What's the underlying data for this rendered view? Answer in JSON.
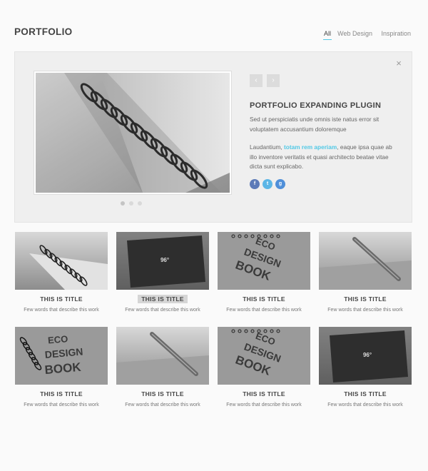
{
  "site_title": "PORTFOLIO",
  "filters": [
    "All",
    "Web Design",
    "Inspiration"
  ],
  "active_filter": "All",
  "accent_color": "#52c9e6",
  "expander": {
    "close_icon": "close-icon",
    "close_glyph": "×",
    "prev_glyph": "‹",
    "next_glyph": "›",
    "title": "PORTFOLIO EXPANDING PLUGIN",
    "paragraph1": "Sed ut perspiciatis unde omnis iste natus error sit voluptatem accusantium doloremque",
    "paragraph2_before": "Laudantium, ",
    "paragraph2_highlight": "totam rem aperiam",
    "paragraph2_after": ", eaque ipsa quae ab illo inventore veritatis et quasi architecto beatae vitae dicta sunt explicabo.",
    "social": [
      {
        "icon": "facebook-icon",
        "glyph": "f"
      },
      {
        "icon": "twitter-icon",
        "glyph": "t"
      },
      {
        "icon": "google-plus-icon",
        "glyph": "g"
      }
    ],
    "slide_count": 3,
    "active_slide": 1
  },
  "items": [
    {
      "title": "THIS IS TITLE",
      "desc": "Few words that describe this work",
      "image": "spiral-notebook"
    },
    {
      "title": "THIS IS TITLE",
      "desc": "Few words that describe this work",
      "image": "notebook-cover"
    },
    {
      "title": "THIS IS TITLE",
      "desc": "Few words that describe this work",
      "image": "eco-design-book"
    },
    {
      "title": "THIS IS TITLE",
      "desc": "Few words that describe this work",
      "image": "pen"
    },
    {
      "title": "THIS IS TITLE",
      "desc": "Few words that describe this work",
      "image": "eco-design-book-side"
    },
    {
      "title": "THIS IS TITLE",
      "desc": "Few words that describe this work",
      "image": "pen"
    },
    {
      "title": "THIS IS TITLE",
      "desc": "Few words that describe this work",
      "image": "eco-design-book"
    },
    {
      "title": "THIS IS TITLE",
      "desc": "Few words that describe this work",
      "image": "notebook-cover"
    }
  ],
  "hovered_item": 2,
  "cover_mark": "96°",
  "book_words": [
    "ECO",
    "DESIGN",
    "BOOK"
  ]
}
